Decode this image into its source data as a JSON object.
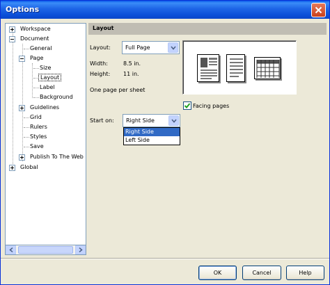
{
  "window": {
    "title": "Options"
  },
  "tree": {
    "items": [
      {
        "label": "Workspace",
        "expander": "plus"
      },
      {
        "label": "Document",
        "expander": "minus"
      },
      {
        "label": "General"
      },
      {
        "label": "Page",
        "expander": "minus"
      },
      {
        "label": "Size"
      },
      {
        "label": "Layout",
        "selected": true
      },
      {
        "label": "Label"
      },
      {
        "label": "Background"
      },
      {
        "label": "Guidelines",
        "expander": "plus"
      },
      {
        "label": "Grid"
      },
      {
        "label": "Rulers"
      },
      {
        "label": "Styles"
      },
      {
        "label": "Save"
      },
      {
        "label": "Publish To The Web",
        "expander": "plus"
      },
      {
        "label": "Global",
        "expander": "plus"
      }
    ]
  },
  "panel": {
    "title": "Layout",
    "layout_label": "Layout:",
    "layout_value": "Full Page",
    "width_label": "Width:",
    "width_value": "8.5 in.",
    "height_label": "Height:",
    "height_value": "11 in.",
    "pages_note": "One page per sheet",
    "facing_pages_label": "Facing pages",
    "facing_pages_checked": true,
    "start_on_label": "Start on:",
    "start_on_value": "Right Side",
    "start_on_options": [
      "Right Side",
      "Left Side"
    ]
  },
  "buttons": {
    "ok": "OK",
    "cancel": "Cancel",
    "help": "Help"
  },
  "colors": {
    "title_bar": "#0a58e8",
    "selection": "#316ac5",
    "check": "#21a121"
  }
}
